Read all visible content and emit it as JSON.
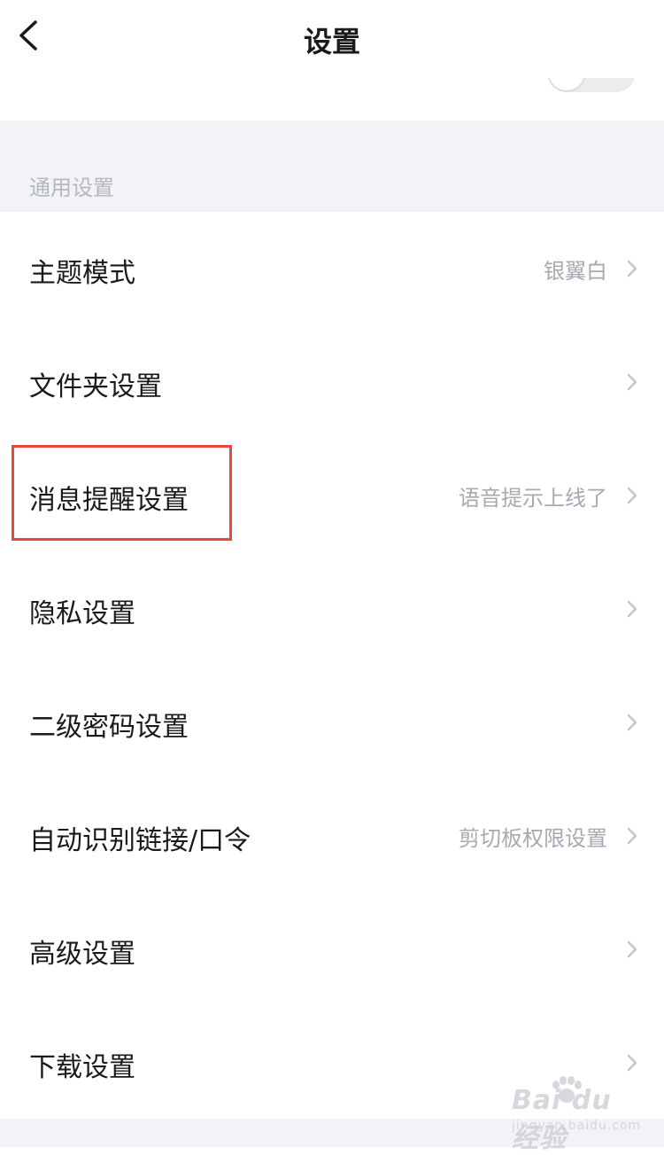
{
  "header": {
    "title": "设置"
  },
  "section": {
    "label": "通用设置"
  },
  "rows": [
    {
      "label": "主题模式",
      "value": "银翼白"
    },
    {
      "label": "文件夹设置",
      "value": ""
    },
    {
      "label": "消息提醒设置",
      "value": "语音提示上线了"
    },
    {
      "label": "隐私设置",
      "value": ""
    },
    {
      "label": "二级密码设置",
      "value": ""
    },
    {
      "label": "自动识别链接/口令",
      "value": "剪切板权限设置"
    },
    {
      "label": "高级设置",
      "value": ""
    },
    {
      "label": "下载设置",
      "value": ""
    }
  ],
  "watermark": {
    "logo": "Bai du 经验",
    "sub": "jingyan.baidu.com"
  },
  "colors": {
    "highlight": "#e8473c",
    "section_bg": "#f2f3f7"
  }
}
